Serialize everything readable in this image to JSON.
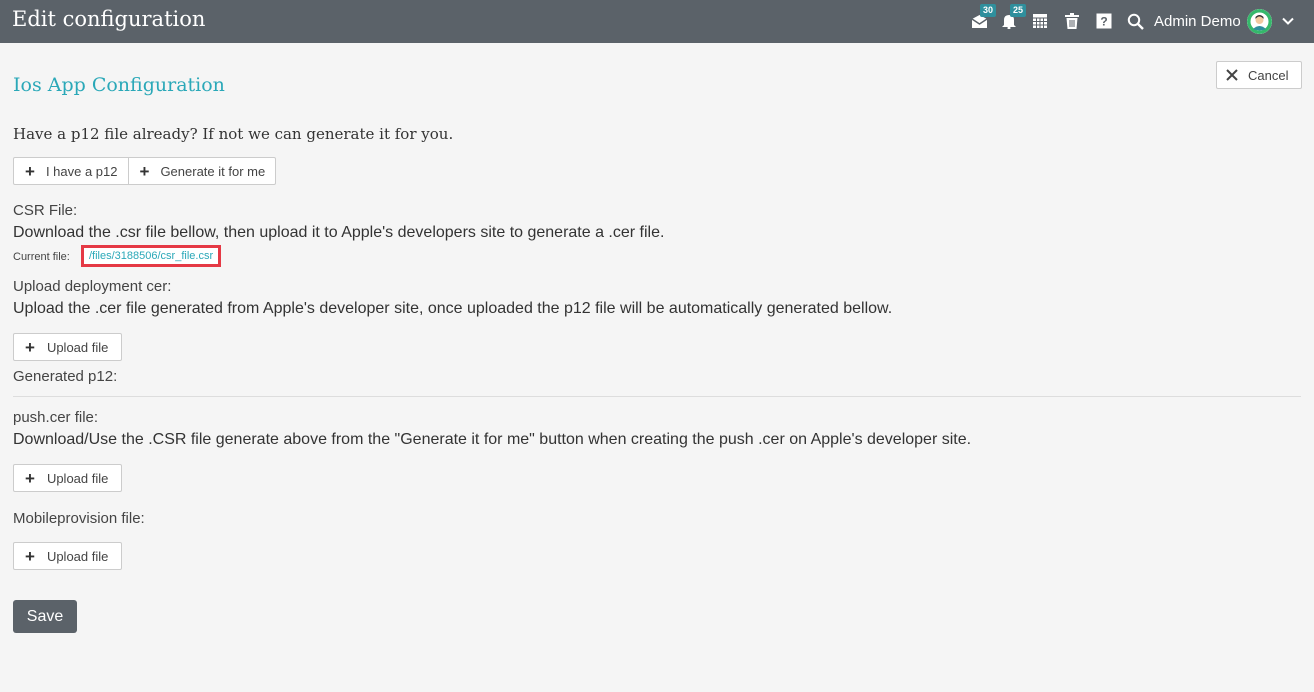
{
  "header": {
    "title": "Edit configuration",
    "messages_badge": "30",
    "notifications_badge": "25",
    "user_name": "Admin Demo"
  },
  "section": {
    "title": "Ios App Configuration",
    "cancel_label": "Cancel"
  },
  "p12": {
    "question": "Have a p12 file already? If not we can generate it for you.",
    "have_label": "I have a p12",
    "generate_label": "Generate it for me"
  },
  "csr": {
    "label": "CSR File:",
    "description": "Download the .csr file bellow, then upload it to Apple's developers site to generate a .cer file.",
    "current_label": "Current file:",
    "file_link": "/files/3188506/csr_file.csr"
  },
  "deployment": {
    "label": "Upload deployment cer:",
    "description": "Upload the .cer file generated from Apple's developer site, once uploaded the p12 file will be automatically generated bellow.",
    "upload_label": "Upload file"
  },
  "generated": {
    "label": "Generated p12:"
  },
  "push": {
    "label": "push.cer file:",
    "description": "Download/Use the .CSR file generate above from the \"Generate it for me\" button when creating the push .cer on Apple's developer site.",
    "upload_label": "Upload file"
  },
  "mobileprovision": {
    "label": "Mobileprovision file:",
    "upload_label": "Upload file"
  },
  "save_label": "Save",
  "icons": {
    "messages": "envelope-icon",
    "notifications": "bell-icon",
    "calendar": "calendar-icon",
    "trash": "trash-icon",
    "help": "help-icon",
    "search": "search-icon"
  },
  "colors": {
    "topbar": "#5b6269",
    "accent": "#2aa8b8",
    "highlight": "#e53945"
  }
}
